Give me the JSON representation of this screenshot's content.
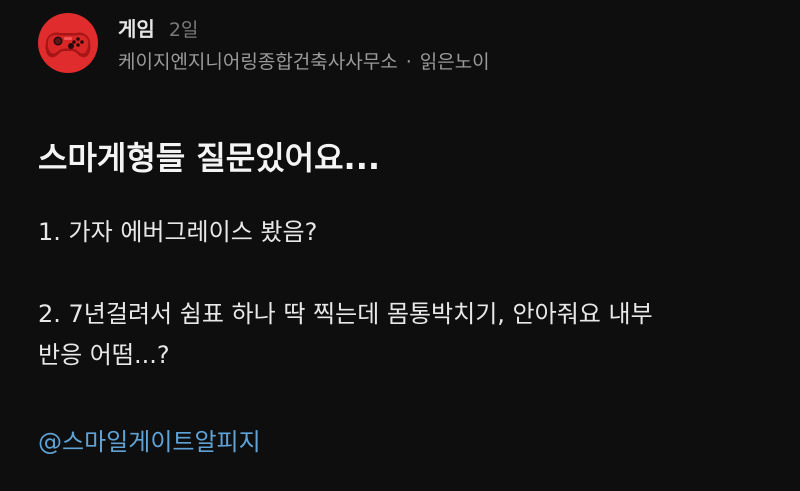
{
  "post": {
    "board": "게임",
    "time": "2일",
    "company": "케이지엔지니어링종합건축사사무소",
    "separator": "·",
    "author": "읽은노이",
    "title": "스마게형들 질문있어요...",
    "lines": [
      "1. 가자 에버그레이스 봤음?",
      "2. 7년걸려서 쉼표 하나 딱 찍는데 몸통박치기, 안아줘요 내부",
      "반응 어떰...?"
    ],
    "mention": "@스마일게이트알피지"
  },
  "colors": {
    "background": "#0e0e0e",
    "avatar": "#e02c2c",
    "mention": "#5fa3d6"
  },
  "icons": {
    "avatar": "game-controller-icon"
  }
}
